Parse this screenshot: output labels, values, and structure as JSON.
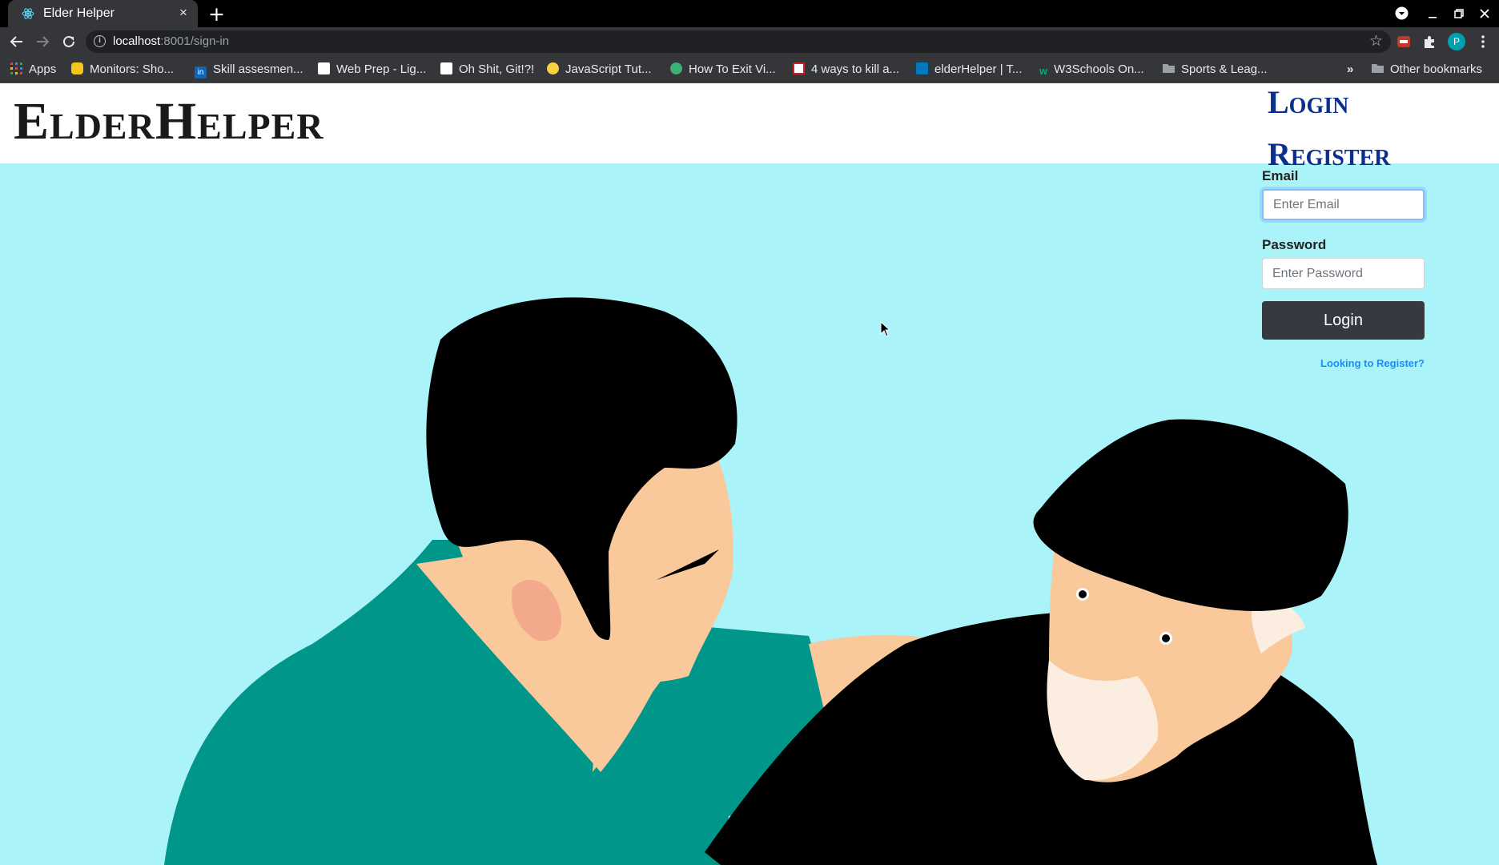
{
  "browser": {
    "tab": {
      "title": "Elder Helper",
      "close_glyph": "×"
    },
    "new_tab_glyph": "+",
    "url_host": "localhost",
    "url_rest": ":8001/sign-in",
    "bookmarks": [
      {
        "label": "Apps",
        "icon": "apps-grid-icon",
        "color": "#e8453c"
      },
      {
        "label": "Monitors: Sho...",
        "icon": "bookmark-favicon-icon",
        "color": "#f5c518"
      },
      {
        "label": "Skill assesmen...",
        "icon": "linkedin-icon",
        "color": "#0a66c2"
      },
      {
        "label": "Web Prep - Lig...",
        "icon": "bookmark-favicon-icon",
        "color": "#ffffff"
      },
      {
        "label": "Oh Shit, Git!?!",
        "icon": "bookmark-favicon-icon",
        "color": "#ffffff"
      },
      {
        "label": "JavaScript Tut...",
        "icon": "python-icon",
        "color": "#f7d23e"
      },
      {
        "label": "How To Exit Vi...",
        "icon": "bookmark-favicon-icon",
        "color": "#3bb273"
      },
      {
        "label": "4 ways to kill a...",
        "icon": "bookmark-favicon-icon",
        "color": "#cc2222"
      },
      {
        "label": "elderHelper | T...",
        "icon": "trello-icon",
        "color": "#0079bf"
      },
      {
        "label": "W3Schools On...",
        "icon": "w3schools-icon",
        "color": "#04aa6d"
      },
      {
        "label": "Sports & Leag...",
        "icon": "folder-icon",
        "color": "#9aa0a6"
      }
    ],
    "more_glyph": "»",
    "other_bookmarks": "Other bookmarks",
    "profile_initial": "P"
  },
  "site": {
    "brand": "ElderHelper",
    "nav": {
      "login": "Login",
      "register": "Register"
    },
    "form": {
      "email_label": "Email",
      "email_placeholder": "Enter Email",
      "password_label": "Password",
      "password_placeholder": "Enter Password",
      "submit": "Login",
      "register_link": "Looking to Register?"
    }
  },
  "colors": {
    "hero_bg": "#aaf4f9",
    "shirt_green": "#00968a",
    "skin": "#f9c99b",
    "hair": "#000000",
    "nav_link": "#0a2f8f",
    "button": "#343a40",
    "register_link": "#1a8cff"
  }
}
